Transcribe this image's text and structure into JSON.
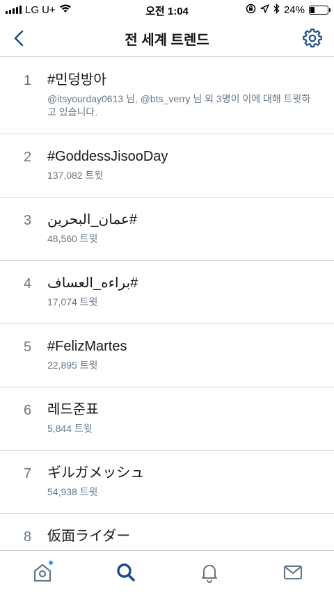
{
  "status_bar": {
    "carrier": "LG U+",
    "time": "오전 1:04",
    "battery_percent": "24%",
    "battery_level": 0.24
  },
  "header": {
    "title": "전 세계 트렌드",
    "back_icon": "chevron-left-icon",
    "settings_icon": "gear-icon"
  },
  "trends": [
    {
      "rank": "1",
      "name": "#민덩방아",
      "meta": "@itsyourday0613 님, @bts_verry 님 외 3명이 이에 대해 트윗하고 있습니다.",
      "rtl": false
    },
    {
      "rank": "2",
      "name": "#GoddessJisooDay",
      "meta": "137,082 트윗",
      "rtl": false
    },
    {
      "rank": "3",
      "name": "#عمان_البحرين",
      "meta": "48,560 트윗",
      "rtl": true
    },
    {
      "rank": "4",
      "name": "#براءه_العساف",
      "meta": "17,074 트윗",
      "rtl": true
    },
    {
      "rank": "5",
      "name": "#FelizMartes",
      "meta": "22,895 트윗",
      "rtl": false
    },
    {
      "rank": "6",
      "name": "레드준표",
      "meta": "5,844 트윗",
      "rtl": false
    },
    {
      "rank": "7",
      "name": "ギルガメッシュ",
      "meta": "54,938 트윗",
      "rtl": false
    },
    {
      "rank": "8",
      "name": "仮面ライダー",
      "meta": "",
      "rtl": false
    }
  ],
  "tab_bar": {
    "items": [
      "home-icon",
      "search-icon",
      "bell-icon",
      "mail-icon"
    ],
    "active": "search-icon",
    "accent_color": "#1da1f2",
    "active_color": "#1c4c8c",
    "inactive_color": "#657786"
  }
}
